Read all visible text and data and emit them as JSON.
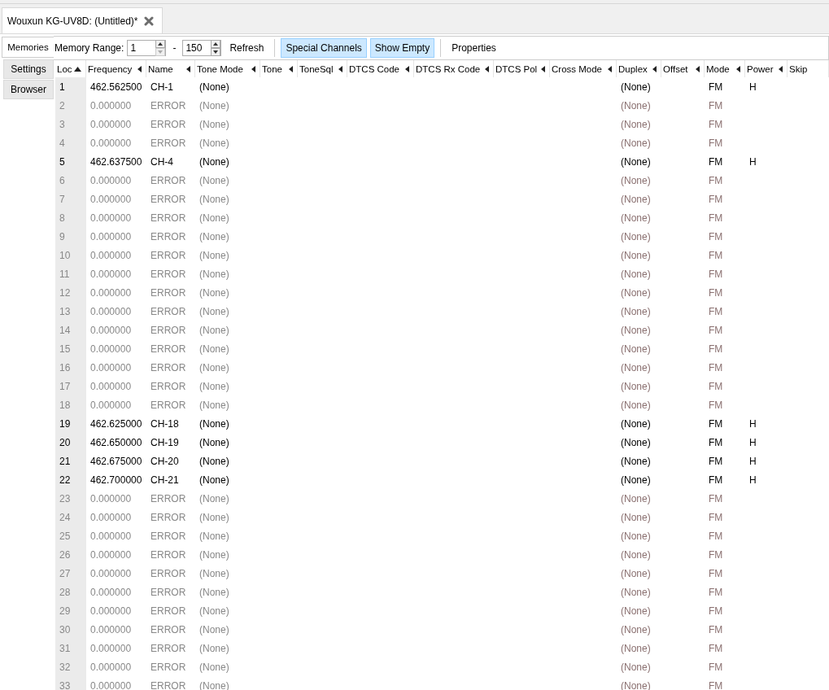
{
  "document_tab": {
    "label": "Wouxun KG-UV8D: (Untitled)*",
    "selected": true
  },
  "side_tabs": [
    {
      "label": "Memories",
      "selected": true
    },
    {
      "label": "Settings",
      "selected": false
    },
    {
      "label": "Browser",
      "selected": false
    }
  ],
  "toolbar": {
    "range_label": "Memory Range:",
    "range_start": "1",
    "range_separator": "-",
    "range_end": "150",
    "refresh": "Refresh",
    "toggles": [
      {
        "label": "Special Channels",
        "on": true
      },
      {
        "label": "Show Empty",
        "on": true
      }
    ],
    "properties": "Properties"
  },
  "table": {
    "columns": [
      {
        "label": "Loc",
        "sorted": true
      },
      {
        "label": "Frequency",
        "sorted": false
      },
      {
        "label": "Name",
        "sorted": false
      },
      {
        "label": "Tone Mode",
        "sorted": false
      },
      {
        "label": "Tone",
        "sorted": false
      },
      {
        "label": "ToneSql",
        "sorted": false
      },
      {
        "label": "DTCS Code",
        "sorted": false
      },
      {
        "label": "DTCS Rx Code",
        "sorted": false
      },
      {
        "label": "DTCS Pol",
        "sorted": false
      },
      {
        "label": "Cross Mode",
        "sorted": false
      },
      {
        "label": "Duplex",
        "sorted": false
      },
      {
        "label": "Offset",
        "sorted": false
      },
      {
        "label": "Mode",
        "sorted": false
      },
      {
        "label": "Power",
        "sorted": false
      },
      {
        "label": "Skip",
        "sorted": false
      }
    ],
    "rows": [
      {
        "loc": "1",
        "frequency": "462.562500",
        "name": "CH-1",
        "tone_mode": "(None)",
        "duplex": "(None)",
        "mode": "FM",
        "power": "H",
        "empty": false
      },
      {
        "loc": "2",
        "frequency": "0.000000",
        "name": "ERROR",
        "tone_mode": "(None)",
        "duplex": "(None)",
        "mode": "FM",
        "empty": true
      },
      {
        "loc": "3",
        "frequency": "0.000000",
        "name": "ERROR",
        "tone_mode": "(None)",
        "duplex": "(None)",
        "mode": "FM",
        "empty": true
      },
      {
        "loc": "4",
        "frequency": "0.000000",
        "name": "ERROR",
        "tone_mode": "(None)",
        "duplex": "(None)",
        "mode": "FM",
        "empty": true
      },
      {
        "loc": "5",
        "frequency": "462.637500",
        "name": "CH-4",
        "tone_mode": "(None)",
        "duplex": "(None)",
        "mode": "FM",
        "power": "H",
        "empty": false
      },
      {
        "loc": "6",
        "frequency": "0.000000",
        "name": "ERROR",
        "tone_mode": "(None)",
        "duplex": "(None)",
        "mode": "FM",
        "empty": true
      },
      {
        "loc": "7",
        "frequency": "0.000000",
        "name": "ERROR",
        "tone_mode": "(None)",
        "duplex": "(None)",
        "mode": "FM",
        "empty": true
      },
      {
        "loc": "8",
        "frequency": "0.000000",
        "name": "ERROR",
        "tone_mode": "(None)",
        "duplex": "(None)",
        "mode": "FM",
        "empty": true
      },
      {
        "loc": "9",
        "frequency": "0.000000",
        "name": "ERROR",
        "tone_mode": "(None)",
        "duplex": "(None)",
        "mode": "FM",
        "empty": true
      },
      {
        "loc": "10",
        "frequency": "0.000000",
        "name": "ERROR",
        "tone_mode": "(None)",
        "duplex": "(None)",
        "mode": "FM",
        "empty": true
      },
      {
        "loc": "11",
        "frequency": "0.000000",
        "name": "ERROR",
        "tone_mode": "(None)",
        "duplex": "(None)",
        "mode": "FM",
        "empty": true
      },
      {
        "loc": "12",
        "frequency": "0.000000",
        "name": "ERROR",
        "tone_mode": "(None)",
        "duplex": "(None)",
        "mode": "FM",
        "empty": true
      },
      {
        "loc": "13",
        "frequency": "0.000000",
        "name": "ERROR",
        "tone_mode": "(None)",
        "duplex": "(None)",
        "mode": "FM",
        "empty": true
      },
      {
        "loc": "14",
        "frequency": "0.000000",
        "name": "ERROR",
        "tone_mode": "(None)",
        "duplex": "(None)",
        "mode": "FM",
        "empty": true
      },
      {
        "loc": "15",
        "frequency": "0.000000",
        "name": "ERROR",
        "tone_mode": "(None)",
        "duplex": "(None)",
        "mode": "FM",
        "empty": true
      },
      {
        "loc": "16",
        "frequency": "0.000000",
        "name": "ERROR",
        "tone_mode": "(None)",
        "duplex": "(None)",
        "mode": "FM",
        "empty": true
      },
      {
        "loc": "17",
        "frequency": "0.000000",
        "name": "ERROR",
        "tone_mode": "(None)",
        "duplex": "(None)",
        "mode": "FM",
        "empty": true
      },
      {
        "loc": "18",
        "frequency": "0.000000",
        "name": "ERROR",
        "tone_mode": "(None)",
        "duplex": "(None)",
        "mode": "FM",
        "empty": true
      },
      {
        "loc": "19",
        "frequency": "462.625000",
        "name": "CH-18",
        "tone_mode": "(None)",
        "duplex": "(None)",
        "mode": "FM",
        "power": "H",
        "empty": false
      },
      {
        "loc": "20",
        "frequency": "462.650000",
        "name": "CH-19",
        "tone_mode": "(None)",
        "duplex": "(None)",
        "mode": "FM",
        "power": "H",
        "empty": false
      },
      {
        "loc": "21",
        "frequency": "462.675000",
        "name": "CH-20",
        "tone_mode": "(None)",
        "duplex": "(None)",
        "mode": "FM",
        "power": "H",
        "empty": false
      },
      {
        "loc": "22",
        "frequency": "462.700000",
        "name": "CH-21",
        "tone_mode": "(None)",
        "duplex": "(None)",
        "mode": "FM",
        "power": "H",
        "empty": false
      },
      {
        "loc": "23",
        "frequency": "0.000000",
        "name": "ERROR",
        "tone_mode": "(None)",
        "duplex": "(None)",
        "mode": "FM",
        "empty": true
      },
      {
        "loc": "24",
        "frequency": "0.000000",
        "name": "ERROR",
        "tone_mode": "(None)",
        "duplex": "(None)",
        "mode": "FM",
        "empty": true
      },
      {
        "loc": "25",
        "frequency": "0.000000",
        "name": "ERROR",
        "tone_mode": "(None)",
        "duplex": "(None)",
        "mode": "FM",
        "empty": true
      },
      {
        "loc": "26",
        "frequency": "0.000000",
        "name": "ERROR",
        "tone_mode": "(None)",
        "duplex": "(None)",
        "mode": "FM",
        "empty": true
      },
      {
        "loc": "27",
        "frequency": "0.000000",
        "name": "ERROR",
        "tone_mode": "(None)",
        "duplex": "(None)",
        "mode": "FM",
        "empty": true
      },
      {
        "loc": "28",
        "frequency": "0.000000",
        "name": "ERROR",
        "tone_mode": "(None)",
        "duplex": "(None)",
        "mode": "FM",
        "empty": true
      },
      {
        "loc": "29",
        "frequency": "0.000000",
        "name": "ERROR",
        "tone_mode": "(None)",
        "duplex": "(None)",
        "mode": "FM",
        "empty": true
      },
      {
        "loc": "30",
        "frequency": "0.000000",
        "name": "ERROR",
        "tone_mode": "(None)",
        "duplex": "(None)",
        "mode": "FM",
        "empty": true
      },
      {
        "loc": "31",
        "frequency": "0.000000",
        "name": "ERROR",
        "tone_mode": "(None)",
        "duplex": "(None)",
        "mode": "FM",
        "empty": true
      },
      {
        "loc": "32",
        "frequency": "0.000000",
        "name": "ERROR",
        "tone_mode": "(None)",
        "duplex": "(None)",
        "mode": "FM",
        "empty": true
      },
      {
        "loc": "33",
        "frequency": "0.000000",
        "name": "ERROR",
        "tone_mode": "(None)",
        "duplex": "(None)",
        "mode": "FM",
        "empty": true
      }
    ]
  }
}
